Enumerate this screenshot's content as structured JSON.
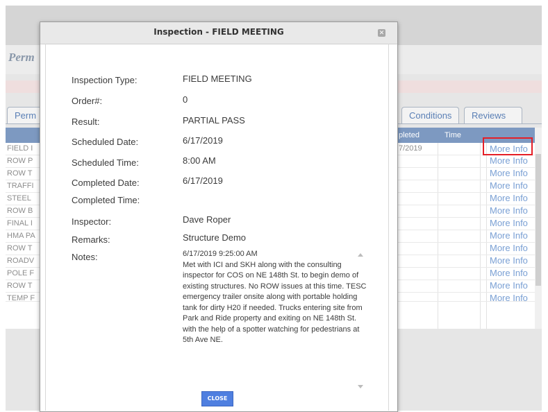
{
  "background": {
    "app_title": "Perm",
    "tabs": [
      {
        "label": "Perm"
      },
      {
        "label": "Conditions"
      },
      {
        "label": "Reviews"
      }
    ],
    "grid": {
      "headers": [
        "pleted",
        "Time"
      ],
      "rows": [
        {
          "name": "FIELD I",
          "date": "7/2019",
          "link": "More Info"
        },
        {
          "name": "ROW P",
          "date": "",
          "link": "More Info"
        },
        {
          "name": "ROW T",
          "date": "",
          "link": "More Info"
        },
        {
          "name": "TRAFFI",
          "date": "",
          "link": "More Info"
        },
        {
          "name": "STEEL",
          "date": "",
          "link": "More Info"
        },
        {
          "name": "ROW B",
          "date": "",
          "link": "More Info"
        },
        {
          "name": "FINAL I",
          "date": "",
          "link": "More Info"
        },
        {
          "name": "HMA PA",
          "date": "",
          "link": "More Info"
        },
        {
          "name": "ROW T",
          "date": "",
          "link": "More Info"
        },
        {
          "name": "ROADV",
          "date": "",
          "link": "More Info"
        },
        {
          "name": "POLE F",
          "date": "",
          "link": "More Info"
        },
        {
          "name": "ROW T",
          "date": "",
          "link": "More Info"
        },
        {
          "name": "TEMP F",
          "date": "",
          "link": "More Info"
        }
      ]
    }
  },
  "modal": {
    "title": "Inspection - FIELD MEETING",
    "fields": [
      {
        "label": "Inspection Type:",
        "value": "FIELD MEETING"
      },
      {
        "label": "Order#:",
        "value": "0"
      },
      {
        "label": "Result:",
        "value": "PARTIAL PASS"
      },
      {
        "label": "Scheduled Date:",
        "value": "6/17/2019"
      },
      {
        "label": "Scheduled Time:",
        "value": "8:00 AM"
      },
      {
        "label": "Completed Date:",
        "value": "6/17/2019"
      },
      {
        "label": "Completed Time:",
        "value": ""
      },
      {
        "label": "Inspector:",
        "value": "Dave Roper"
      },
      {
        "label": "Remarks:",
        "value": "Structure Demo"
      }
    ],
    "notes_label": "Notes:",
    "notes_lines": [
      "6/17/2019 9:25:00 AM",
      "Met with ICI and SKH along with the consulting",
      "inspector for COS on NE 148th St. to begin demo of",
      "existing structures. No ROW issues at this time. TESC",
      "emergency trailer onsite along with portable holding",
      "tank for dirty H20 if needed. Trucks entering site from",
      "Park and Ride property and exiting on NE 148th St.",
      "with the help of a spotter watching for pedestrians at",
      "5th Ave NE."
    ],
    "close_label": "CLOSE"
  },
  "colors": {
    "grid_header": "#7d99c1",
    "link": "#7aa0d4",
    "highlight": "#e41e26",
    "close_button": "#4f7fe0"
  }
}
